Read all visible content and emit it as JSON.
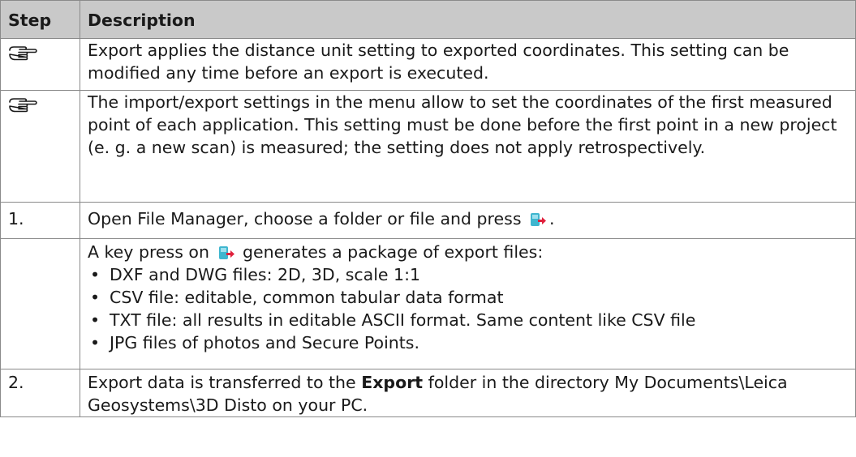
{
  "header": {
    "step": "Step",
    "description": "Description"
  },
  "icons": {
    "note": "pointing-hand-icon",
    "export": "export-icon",
    "export_color": "#e0203c",
    "export_page_color": "#3fb6cf"
  },
  "rows": [
    {
      "step_icon": "pointing-hand-icon",
      "text": "Export applies the distance unit setting to exported coordinates. This setting can be modified any time before an export is executed."
    },
    {
      "step_icon": "pointing-hand-icon",
      "text": "The import/export settings in the menu allow to set the coordinates of the first measured point of each application. This setting must be done before the first point in a new project (e. g. a new scan) is measured; the setting does not apply retrospectively."
    },
    {
      "step": "1.",
      "text_before": "Open File Manager, choose a folder or file and press",
      "text_after": "."
    },
    {
      "step": "",
      "text_before": "A key press on",
      "text_after": "generates a package of export files:",
      "bullets": [
        "DXF and DWG files: 2D, 3D, scale 1:1",
        "CSV file: editable, common tabular data format",
        "TXT file: all results in editable ASCII format. Same content like CSV file",
        "JPG files of photos and Secure Points."
      ]
    },
    {
      "step": "2.",
      "text_before": "Export data is transferred to the",
      "text_bold": "Export",
      "text_after": "folder in the directory My Documents\\Leica Geosystems\\3D Disto on your PC."
    }
  ]
}
